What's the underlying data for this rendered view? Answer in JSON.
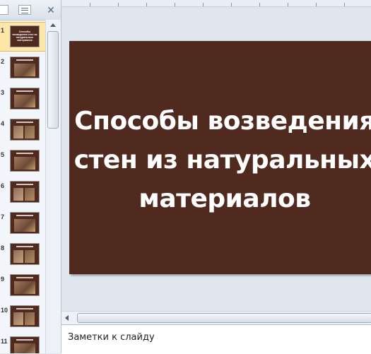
{
  "left_pane": {
    "close_glyph": "✕",
    "slides": [
      {
        "number": "1",
        "title": "Способы возведения стен из натуральных материалов",
        "selected": true
      },
      {
        "number": "2"
      },
      {
        "number": "3"
      },
      {
        "number": "4"
      },
      {
        "number": "5"
      },
      {
        "number": "6"
      },
      {
        "number": "7"
      },
      {
        "number": "8"
      },
      {
        "number": "9"
      },
      {
        "number": "10"
      },
      {
        "number": "11"
      }
    ]
  },
  "slide": {
    "background": "#512a1f",
    "title_line1": "Способы возведения",
    "title_line2": "стен из натуральных",
    "title_line3": "материалов"
  },
  "notes": {
    "placeholder": "Заметки к слайду"
  }
}
